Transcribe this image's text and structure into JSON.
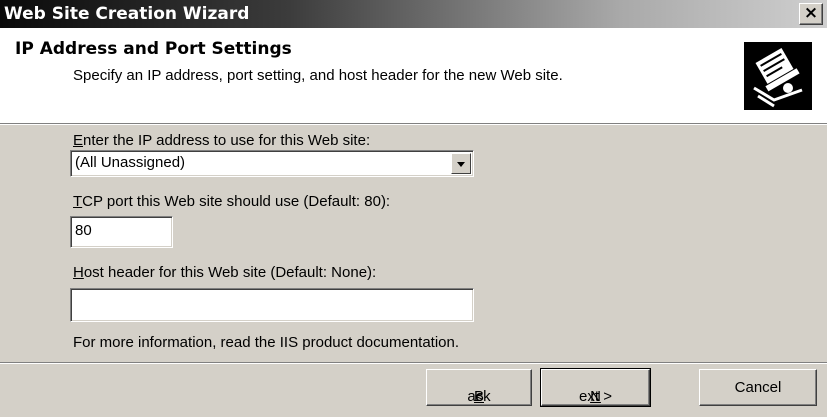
{
  "window": {
    "title": "Web Site Creation Wizard",
    "close_label": "×"
  },
  "header": {
    "title": "IP Address and Port Settings",
    "subtitle": "Specify an IP address, port setting, and host header for the new Web site."
  },
  "ip": {
    "label_mnemonic": "E",
    "label_rest": "nter the IP address to use for this Web site:",
    "value": "(All Unassigned)"
  },
  "port": {
    "label_mnemonic": "T",
    "label_rest": "CP port this Web site should use (Default: 80):",
    "value": "80"
  },
  "host": {
    "label_mnemonic": "H",
    "label_rest": "ost header for this Web site (Default: None):",
    "value": ""
  },
  "info_text": "For more information, read the IIS product documentation.",
  "buttons": {
    "back_prefix": "< ",
    "back_mnemonic": "B",
    "back_rest": "ack",
    "next_mnemonic": "N",
    "next_rest": "ext >",
    "cancel": "Cancel"
  },
  "icons": {
    "wizard": "wizard-book-icon",
    "dropdown": "chevron-down-icon",
    "close": "close-icon"
  }
}
